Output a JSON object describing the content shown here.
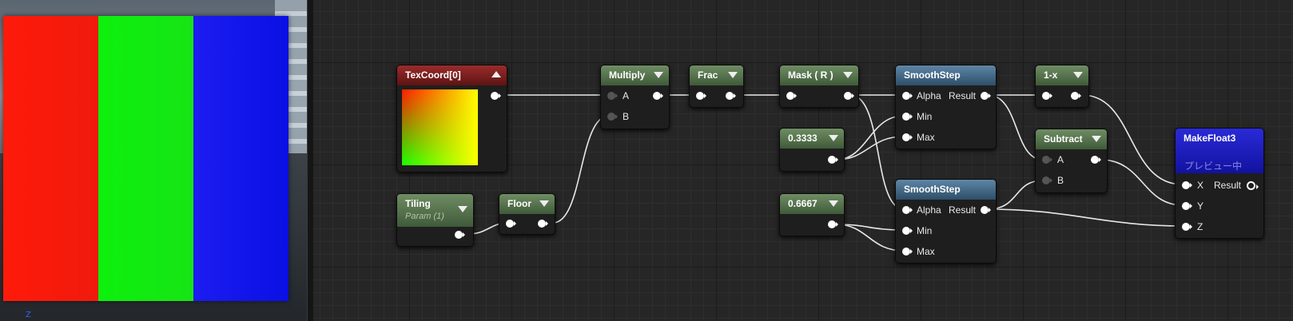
{
  "preview": {
    "colors": [
      "#ff1a0a",
      "#0df00d",
      "#1c1cf0"
    ],
    "axis_label": "Z"
  },
  "nodes": {
    "texcoord": {
      "title": "TexCoord[0]"
    },
    "tiling": {
      "title": "Tiling",
      "subtitle": "Param (1)"
    },
    "floor": {
      "title": "Floor"
    },
    "multiply": {
      "title": "Multiply",
      "pin_a": "A",
      "pin_b": "B"
    },
    "frac": {
      "title": "Frac"
    },
    "mask": {
      "title": "Mask ( R )"
    },
    "const1": {
      "title": "0.3333"
    },
    "const2": {
      "title": "0.6667"
    },
    "smooth1": {
      "title": "SmoothStep",
      "alpha": "Alpha",
      "result": "Result",
      "min": "Min",
      "max": "Max"
    },
    "smooth2": {
      "title": "SmoothStep",
      "alpha": "Alpha",
      "result": "Result",
      "min": "Min",
      "max": "Max"
    },
    "oneminus": {
      "title": "1-x"
    },
    "subtract": {
      "title": "Subtract",
      "pin_a": "A",
      "pin_b": "B"
    },
    "makefloat3": {
      "title": "MakeFloat3",
      "preview_note": "プレビュー中",
      "x": "X",
      "y": "Y",
      "z": "Z",
      "result": "Result"
    }
  },
  "colors": {
    "header_green": "#4f6b48",
    "header_blue": "#3e6483",
    "header_red": "#7a1f1f",
    "header_navy": "#1c1cc0"
  }
}
